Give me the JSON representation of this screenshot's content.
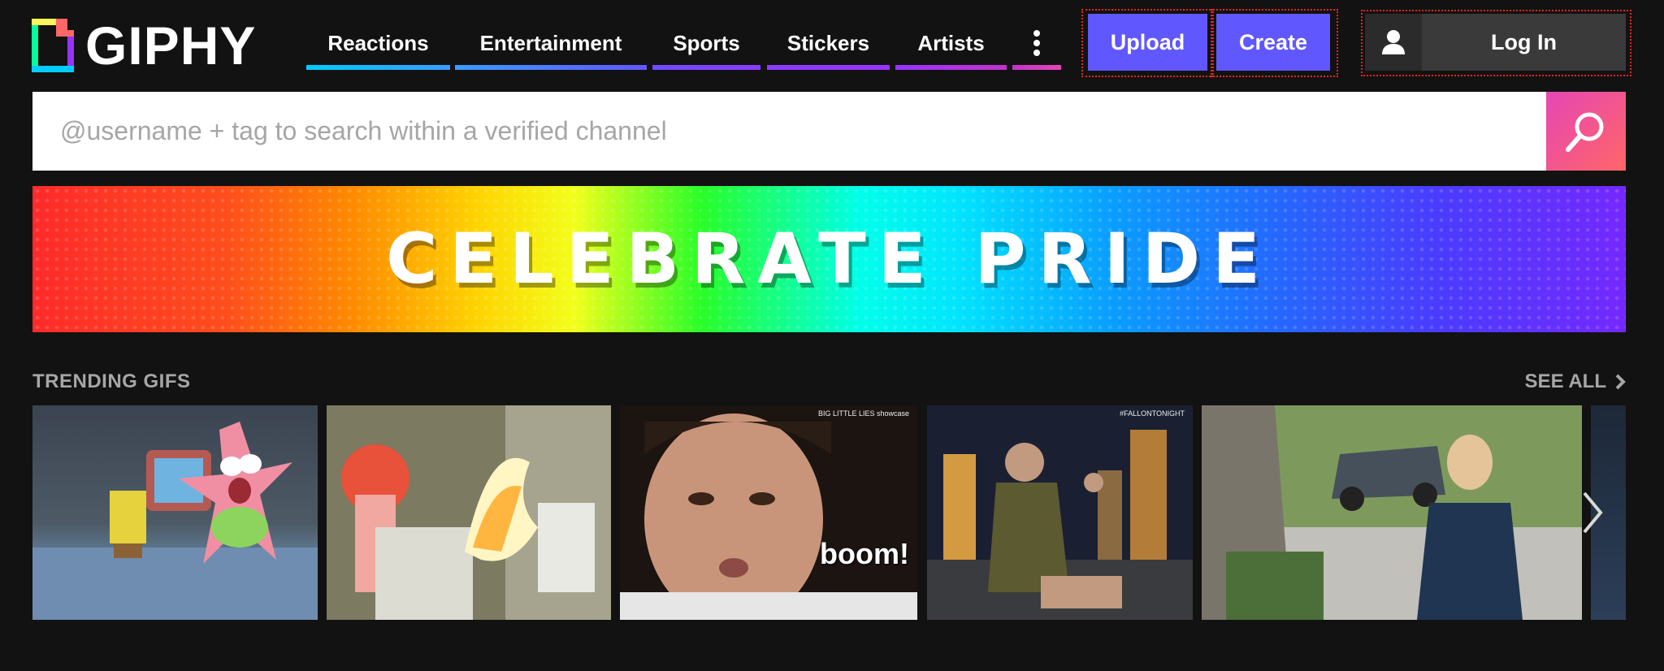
{
  "brand": {
    "name": "GIPHY"
  },
  "nav": {
    "items": [
      {
        "label": "Reactions",
        "color": "#00ccff"
      },
      {
        "label": "Entertainment",
        "color": "#6157ff"
      },
      {
        "label": "Sports",
        "color": "#9933ff"
      },
      {
        "label": "Stickers",
        "color": "#9933ff"
      },
      {
        "label": "Artists",
        "color": "#cc33cc"
      }
    ],
    "more_icon": "vertical-dots-icon"
  },
  "actions": {
    "upload_label": "Upload",
    "create_label": "Create",
    "login_label": "Log In",
    "login_icon": "user-icon"
  },
  "search": {
    "placeholder": "@username + tag to search within a verified channel",
    "icon": "search-icon"
  },
  "banner": {
    "text": "CELEBRATE PRIDE"
  },
  "trending": {
    "title": "TRENDING GIFS",
    "see_all": "SEE ALL",
    "gifs": [
      {
        "name": "spongebob-patrick-gif"
      },
      {
        "name": "beaker-muppet-gif"
      },
      {
        "name": "boom-gif",
        "watermark": "BIG LITTLE LIES showcase",
        "caption": "boom!"
      },
      {
        "name": "fallon-guest-gif",
        "watermark": "#FALLONTONIGHT"
      },
      {
        "name": "reese-witherspoon-gif"
      }
    ]
  },
  "colors": {
    "background": "#121212",
    "accent": "#6157ff",
    "search_gradient": [
      "#e646b6",
      "#ff6666"
    ]
  }
}
